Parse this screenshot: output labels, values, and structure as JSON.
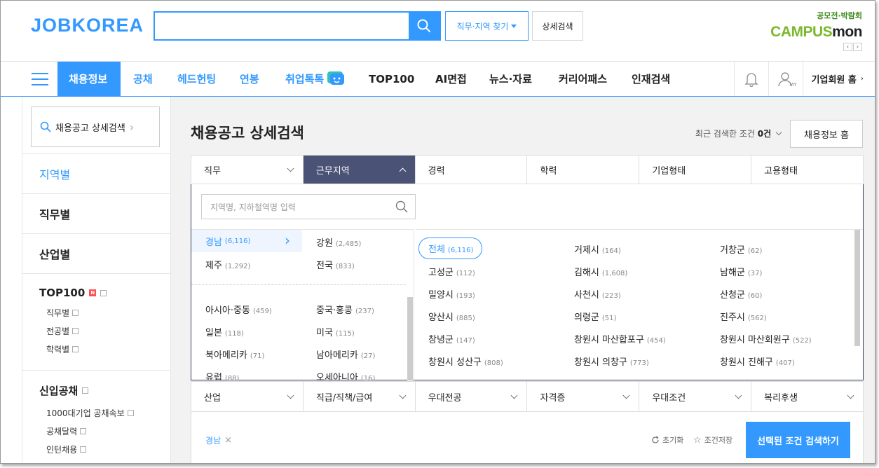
{
  "header": {
    "logo": "JOBKOREA",
    "search_placeholder": "",
    "job_area_button": "직무·지역 찾기",
    "detail_search_button": "상세검색",
    "campus_sub": "공모전·박람회",
    "campus_brand_a": "CAMPUS",
    "campus_brand_b": "mon"
  },
  "nav": {
    "items": [
      "채용정보",
      "공채",
      "헤드헌팅",
      "연봉",
      "취업톡톡",
      "TOP100",
      "AI면접",
      "뉴스·자료",
      "커리어패스",
      "인재검색"
    ],
    "my_label": "MY",
    "corp_home": "기업회원 홈"
  },
  "sidebar": {
    "search_label": "채용공고 상세검색",
    "links": [
      "지역별",
      "직무별",
      "산업별"
    ],
    "top100": {
      "title": "TOP100",
      "badge": "N",
      "subs": [
        "직무별",
        "전공별",
        "학력별"
      ]
    },
    "gongchae": {
      "title": "신입공채",
      "subs": [
        "1000대기업 공채속보",
        "공채달력",
        "인턴채용"
      ]
    }
  },
  "main": {
    "title": "채용공고 상세검색",
    "recent_prefix": "최근 검색한 조건",
    "recent_count": "0건",
    "home_button": "채용정보 홈",
    "tabs_top": [
      "직무",
      "근무지역",
      "경력",
      "학력",
      "기업형태",
      "고용형태"
    ],
    "tabs_bottom": [
      "산업",
      "직급/직책/급여",
      "우대전공",
      "자격증",
      "우대조건",
      "복리후생"
    ],
    "region_placeholder": "지역명, 지하철역명 입력",
    "left_regions": [
      {
        "name": "경남",
        "count": "(6,116)"
      },
      {
        "name": "강원",
        "count": "(2,485)"
      },
      {
        "name": "제주",
        "count": "(1,292)"
      },
      {
        "name": "전국",
        "count": "(833)"
      },
      {
        "name": "아시아·중동",
        "count": "(459)"
      },
      {
        "name": "중국·홍콩",
        "count": "(237)"
      },
      {
        "name": "일본",
        "count": "(118)"
      },
      {
        "name": "미국",
        "count": "(115)"
      },
      {
        "name": "북아메리카",
        "count": "(71)"
      },
      {
        "name": "남아메리카",
        "count": "(27)"
      },
      {
        "name": "유럽",
        "count": "(88)"
      },
      {
        "name": "오세아니아",
        "count": "(16)"
      }
    ],
    "sub_regions": [
      {
        "name": "전체",
        "count": "(6,116)"
      },
      {
        "name": "거제시",
        "count": "(164)"
      },
      {
        "name": "거창군",
        "count": "(62)"
      },
      {
        "name": "고성군",
        "count": "(112)"
      },
      {
        "name": "김해시",
        "count": "(1,608)"
      },
      {
        "name": "남해군",
        "count": "(37)"
      },
      {
        "name": "밀양시",
        "count": "(193)"
      },
      {
        "name": "사천시",
        "count": "(223)"
      },
      {
        "name": "산청군",
        "count": "(60)"
      },
      {
        "name": "양산시",
        "count": "(885)"
      },
      {
        "name": "의령군",
        "count": "(51)"
      },
      {
        "name": "진주시",
        "count": "(562)"
      },
      {
        "name": "창녕군",
        "count": "(147)"
      },
      {
        "name": "창원시 마산합포구",
        "count": "(454)"
      },
      {
        "name": "창원시 마산회원구",
        "count": "(522)"
      },
      {
        "name": "창원시 성산구",
        "count": "(808)"
      },
      {
        "name": "창원시 의창구",
        "count": "(773)"
      },
      {
        "name": "창원시 진해구",
        "count": "(407)"
      }
    ],
    "selected_tag": "경남",
    "reset_label": "초기화",
    "save_label": "조건저장",
    "search_button": "선택된 조건 검색하기"
  },
  "colors": {
    "brand": "#3399ff",
    "active_tab": "#4a5275"
  }
}
